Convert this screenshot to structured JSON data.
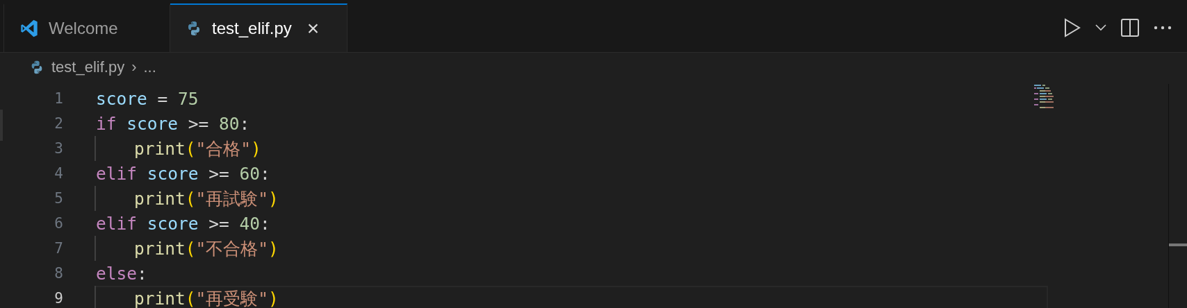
{
  "tabs": [
    {
      "label": "Welcome",
      "kind": "app",
      "selected": false
    },
    {
      "label": "test_elif.py",
      "kind": "file",
      "selected": true
    }
  ],
  "close_glyph": "×",
  "breadcrumb": {
    "file": "test_elif.py",
    "separator": "›",
    "rest": "..."
  },
  "lines": [
    {
      "number": "1",
      "indented": false,
      "current": false,
      "tokens": [
        {
          "kind": "var",
          "text": "score"
        },
        {
          "kind": "op",
          "text": " = "
        },
        {
          "kind": "num",
          "text": "75"
        }
      ]
    },
    {
      "number": "2",
      "indented": false,
      "current": false,
      "tokens": [
        {
          "kind": "kw",
          "text": "if"
        },
        {
          "kind": "var",
          "text": " score"
        },
        {
          "kind": "op",
          "text": " >= "
        },
        {
          "kind": "num",
          "text": "80"
        },
        {
          "kind": "op",
          "text": ":"
        }
      ]
    },
    {
      "number": "3",
      "indented": true,
      "current": false,
      "tokens": [
        {
          "kind": "fn",
          "text": "print"
        },
        {
          "kind": "paren",
          "text": "("
        },
        {
          "kind": "str",
          "text": "\"合格\""
        },
        {
          "kind": "paren",
          "text": ")"
        }
      ]
    },
    {
      "number": "4",
      "indented": false,
      "current": false,
      "tokens": [
        {
          "kind": "kw",
          "text": "elif"
        },
        {
          "kind": "var",
          "text": " score"
        },
        {
          "kind": "op",
          "text": " >= "
        },
        {
          "kind": "num",
          "text": "60"
        },
        {
          "kind": "op",
          "text": ":"
        }
      ]
    },
    {
      "number": "5",
      "indented": true,
      "current": false,
      "tokens": [
        {
          "kind": "fn",
          "text": "print"
        },
        {
          "kind": "paren",
          "text": "("
        },
        {
          "kind": "str",
          "text": "\"再試験\""
        },
        {
          "kind": "paren",
          "text": ")"
        }
      ]
    },
    {
      "number": "6",
      "indented": false,
      "current": false,
      "tokens": [
        {
          "kind": "kw",
          "text": "elif"
        },
        {
          "kind": "var",
          "text": " score"
        },
        {
          "kind": "op",
          "text": " >= "
        },
        {
          "kind": "num",
          "text": "40"
        },
        {
          "kind": "op",
          "text": ":"
        }
      ]
    },
    {
      "number": "7",
      "indented": true,
      "current": false,
      "tokens": [
        {
          "kind": "fn",
          "text": "print"
        },
        {
          "kind": "paren",
          "text": "("
        },
        {
          "kind": "str",
          "text": "\"不合格\""
        },
        {
          "kind": "paren",
          "text": ")"
        }
      ]
    },
    {
      "number": "8",
      "indented": false,
      "current": false,
      "tokens": [
        {
          "kind": "kw",
          "text": "else"
        },
        {
          "kind": "op",
          "text": ":"
        }
      ]
    },
    {
      "number": "9",
      "indented": true,
      "current": true,
      "tokens": [
        {
          "kind": "fn",
          "text": "print"
        },
        {
          "kind": "paren",
          "text": "("
        },
        {
          "kind": "str",
          "text": "\"再受験\""
        },
        {
          "kind": "paren",
          "text": ")"
        }
      ]
    }
  ]
}
